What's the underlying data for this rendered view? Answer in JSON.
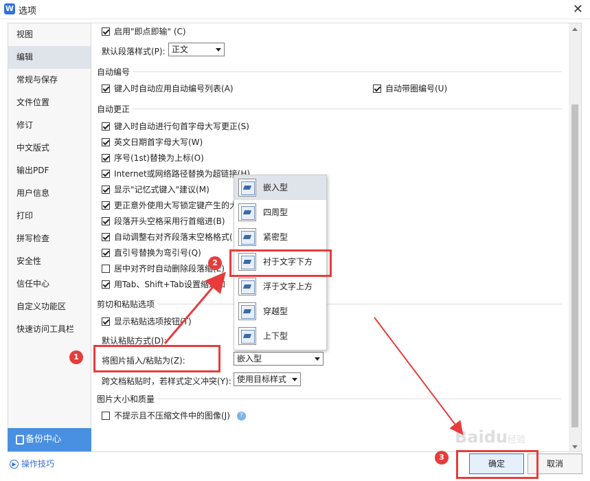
{
  "window": {
    "title": "选项"
  },
  "sidebar": {
    "items": [
      {
        "label": "视图"
      },
      {
        "label": "编辑"
      },
      {
        "label": "常规与保存"
      },
      {
        "label": "文件位置"
      },
      {
        "label": "修订"
      },
      {
        "label": "中文版式"
      },
      {
        "label": "输出PDF"
      },
      {
        "label": "用户信息"
      },
      {
        "label": "打印"
      },
      {
        "label": "拼写检查"
      },
      {
        "label": "安全性"
      },
      {
        "label": "信任中心"
      },
      {
        "label": "自定义功能区"
      },
      {
        "label": "快速访问工具栏"
      }
    ],
    "active_index": 1,
    "backup_label": "备份中心",
    "tips_label": "操作技巧"
  },
  "main": {
    "instant_input": "启用\"即点即输\" (C)",
    "default_para_label": "默认段落样式(P):",
    "default_para_value": "正文",
    "sections": {
      "auto_number": "自动编号",
      "auto_correct": "自动更正",
      "cut_paste": "剪切和粘贴选项",
      "image_quality": "图片大小和质量"
    },
    "auto_number": {
      "apply_list": "键入时自动应用自动编号列表(A)",
      "circle_number": "自动带圈编号(U)"
    },
    "auto_correct": [
      {
        "label": "键入时自动进行句首字母大写更正(S)",
        "checked": true
      },
      {
        "label": "英文日期首字母大写(W)",
        "checked": true
      },
      {
        "label": "序号(1st)替换为上标(O)",
        "checked": true
      },
      {
        "label": "Internet或网络路径替换为超链接(H)",
        "checked": true
      },
      {
        "label": "显示\"记忆式键入\"建议(M)",
        "checked": true
      },
      {
        "label": "更正意外使用大写锁定键产生的大",
        "checked": true
      },
      {
        "label": "段落开头空格采用行首缩进(B)",
        "checked": true
      },
      {
        "label": "自动调整右对齐段落末空格格式(",
        "checked": true
      },
      {
        "label": "直引号替换为弯引号(Q)",
        "checked": true
      },
      {
        "label": "居中对齐时自动删除段落缩(E)",
        "checked": false
      },
      {
        "label": "用Tab、Shift+Tab设置缩进和",
        "checked": true
      }
    ],
    "cut_paste": {
      "show_paste_button": "显示粘贴选项按钮(T)",
      "default_paste_label": "默认粘贴方式(D):",
      "insert_image_label": "将图片插入/粘贴为(Z):",
      "insert_image_value": "嵌入型",
      "cross_doc_label": "跨文档粘贴时，若样式定义冲突(Y):",
      "cross_doc_value": "使用目标样式"
    },
    "image_quality": {
      "no_compress": "不提示且不压缩文件中的图像(J)",
      "help": "?"
    }
  },
  "dropdown": {
    "items": [
      {
        "label": "嵌入型"
      },
      {
        "label": "四周型"
      },
      {
        "label": "紧密型"
      },
      {
        "label": "衬于文字下方"
      },
      {
        "label": "浮于文字上方"
      },
      {
        "label": "穿越型"
      },
      {
        "label": "上下型"
      }
    ],
    "active_index": 0,
    "highlight_index": 3
  },
  "buttons": {
    "ok": "确定",
    "cancel": "取消"
  },
  "annotations": {
    "badge1": "1",
    "badge2": "2",
    "badge3": "3"
  },
  "watermark": {
    "text": "Baidu",
    "sub": "经验"
  },
  "colors": {
    "annotation_red": "#e83b3b",
    "accent_blue": "#4a90e2"
  }
}
